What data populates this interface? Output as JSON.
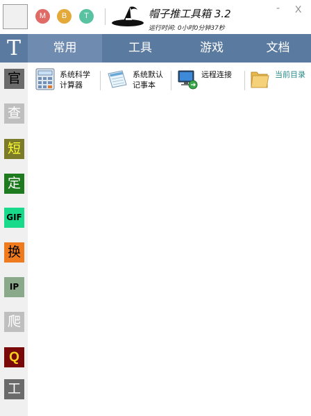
{
  "window": {
    "title": "帽子推工具箱 3.2",
    "runtime": "运行时间: 0小时0分钟37秒",
    "minimize_label": "-",
    "close_label": "X"
  },
  "header_buttons": [
    {
      "label": "M",
      "color": "#e06a65"
    },
    {
      "label": "B",
      "color": "#e3a939"
    },
    {
      "label": "T",
      "color": "#59c2a1"
    }
  ],
  "sidebar": {
    "logo": "T",
    "items": [
      {
        "label": "官",
        "bg": "#6b6b6b",
        "fg": "#000000"
      },
      {
        "label": "查",
        "bg": "#bfbfbf",
        "fg": "#ffffff"
      },
      {
        "label": "短",
        "bg": "#7b7b2a",
        "fg": "#ffff33"
      },
      {
        "label": "定",
        "bg": "#1e7a1e",
        "fg": "#ffffff"
      },
      {
        "label": "GIF",
        "bg": "#19d98a",
        "fg": "#000000"
      },
      {
        "label": "换",
        "bg": "#f07a1e",
        "fg": "#000000"
      },
      {
        "label": "IP",
        "bg": "#8aa88a",
        "fg": "#000000"
      },
      {
        "label": "爬",
        "bg": "#bfbfbf",
        "fg": "#ffffff"
      },
      {
        "label": "Q",
        "bg": "#7a0a0a",
        "fg": "#ffd21e"
      },
      {
        "label": "工",
        "bg": "#6b6b6b",
        "fg": "#ffffff"
      }
    ]
  },
  "tabs": [
    {
      "label": "常用",
      "active": true
    },
    {
      "label": "工具",
      "active": false
    },
    {
      "label": "游戏",
      "active": false
    },
    {
      "label": "文档",
      "active": false
    }
  ],
  "tools": [
    {
      "label": "系统科学\n计算器",
      "icon": "calculator-icon"
    },
    {
      "label": "系统默认\n记事本",
      "icon": "notepad-icon"
    },
    {
      "label": "远程连接",
      "icon": "remote-desktop-icon"
    },
    {
      "label": "当前目录",
      "icon": "folder-icon"
    }
  ]
}
